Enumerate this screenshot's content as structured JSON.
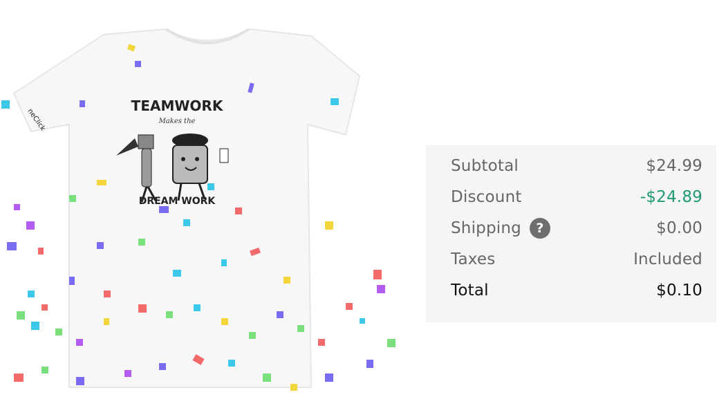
{
  "product": {
    "shirt_print": {
      "top_text": "TEAMWORK",
      "script_text": "Makes the",
      "bottom_text": "DREAM WORK",
      "sleeve_text": "neClick"
    }
  },
  "summary": {
    "subtotal": {
      "label": "Subtotal",
      "value": "$24.99"
    },
    "discount": {
      "label": "Discount",
      "value": "-$24.89"
    },
    "shipping": {
      "label": "Shipping",
      "value": "$0.00",
      "help_icon": "question-circle-icon",
      "help_glyph": "?"
    },
    "taxes": {
      "label": "Taxes",
      "value": "Included"
    },
    "total": {
      "label": "Total",
      "value": "$0.10"
    }
  },
  "colors": {
    "discount": "#1f9a6d",
    "panel_bg": "#f5f5f5",
    "confetti": [
      "#7a6cf0",
      "#3cc8e8",
      "#f3d53c",
      "#f26a6a",
      "#5ed67a",
      "#b35cf0"
    ]
  }
}
